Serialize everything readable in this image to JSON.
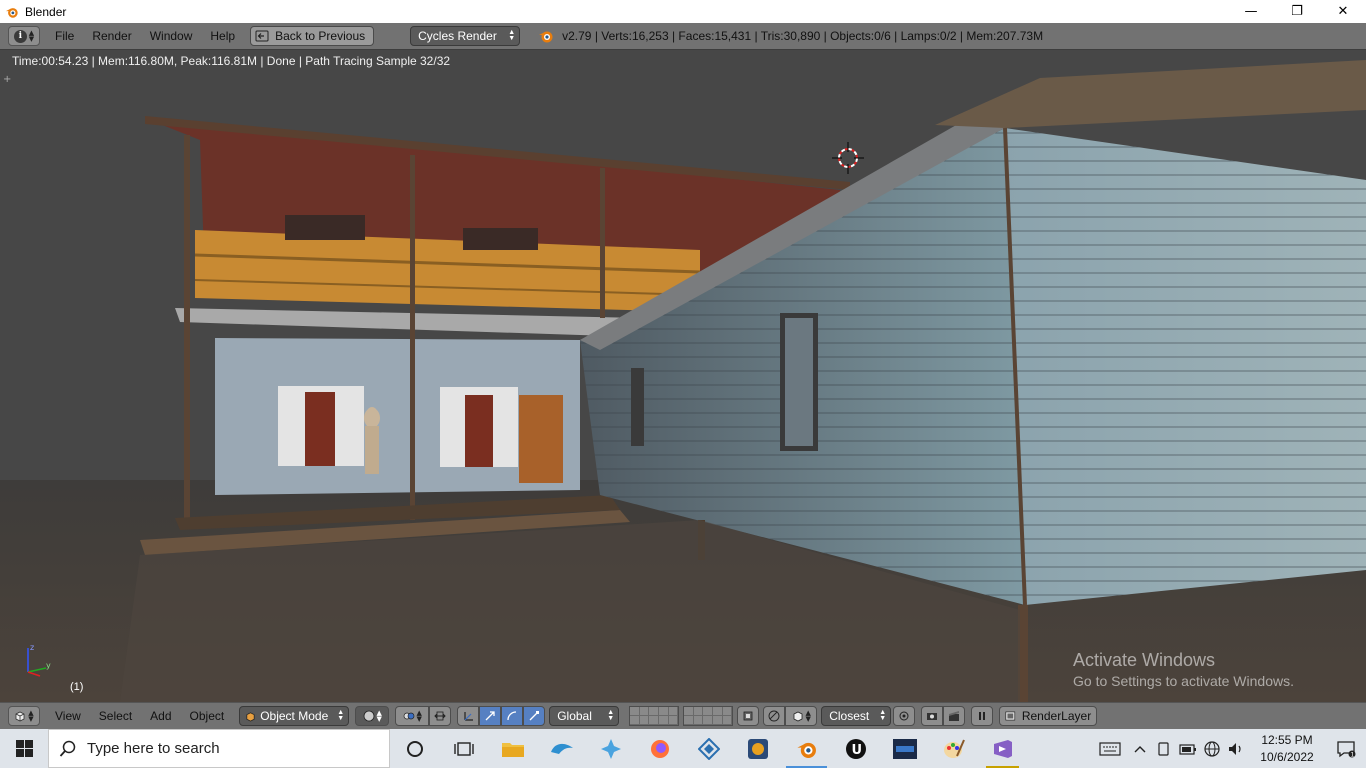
{
  "window": {
    "title": "Blender",
    "minimize": "—",
    "maximize": "❐",
    "close": "✕"
  },
  "info_header": {
    "menus": [
      "File",
      "Render",
      "Window",
      "Help"
    ],
    "back_button": "Back to Previous",
    "render_engine": "Cycles Render",
    "stats": "v2.79 | Verts:16,253 | Faces:15,431 | Tris:30,890 | Objects:0/6 | Lamps:0/2 | Mem:207.73M"
  },
  "viewport": {
    "render_info": "Time:00:54.23 | Mem:116.80M, Peak:116.81M | Done | Path Tracing Sample 32/32",
    "frame_number": "(1)",
    "activate_title": "Activate Windows",
    "activate_subtitle": "Go to Settings to activate Windows."
  },
  "view_header": {
    "menus": [
      "View",
      "Select",
      "Add",
      "Object"
    ],
    "mode": "Object Mode",
    "orientation": "Global",
    "snap_target": "Closest",
    "render_layer": "RenderLayer"
  },
  "taskbar": {
    "search_placeholder": "Type here to search",
    "time": "12:55 PM",
    "date": "10/6/2022",
    "apps": [
      "cortana-icon",
      "task-view-icon",
      "file-explorer-icon",
      "dolphin-app-icon",
      "puzzle-app-icon",
      "firefox-icon",
      "sketchup-icon",
      "media-app-icon",
      "blender-icon",
      "unreal-engine-icon",
      "game-app-icon",
      "paint-icon",
      "visual-studio-icon"
    ]
  },
  "colors": {
    "blender_header": "#727272",
    "viewport_bg": "#474747",
    "active_tool": "#5680c2",
    "taskbar_bg": "#dfe4ea",
    "blender_orange": "#e87d0d"
  }
}
